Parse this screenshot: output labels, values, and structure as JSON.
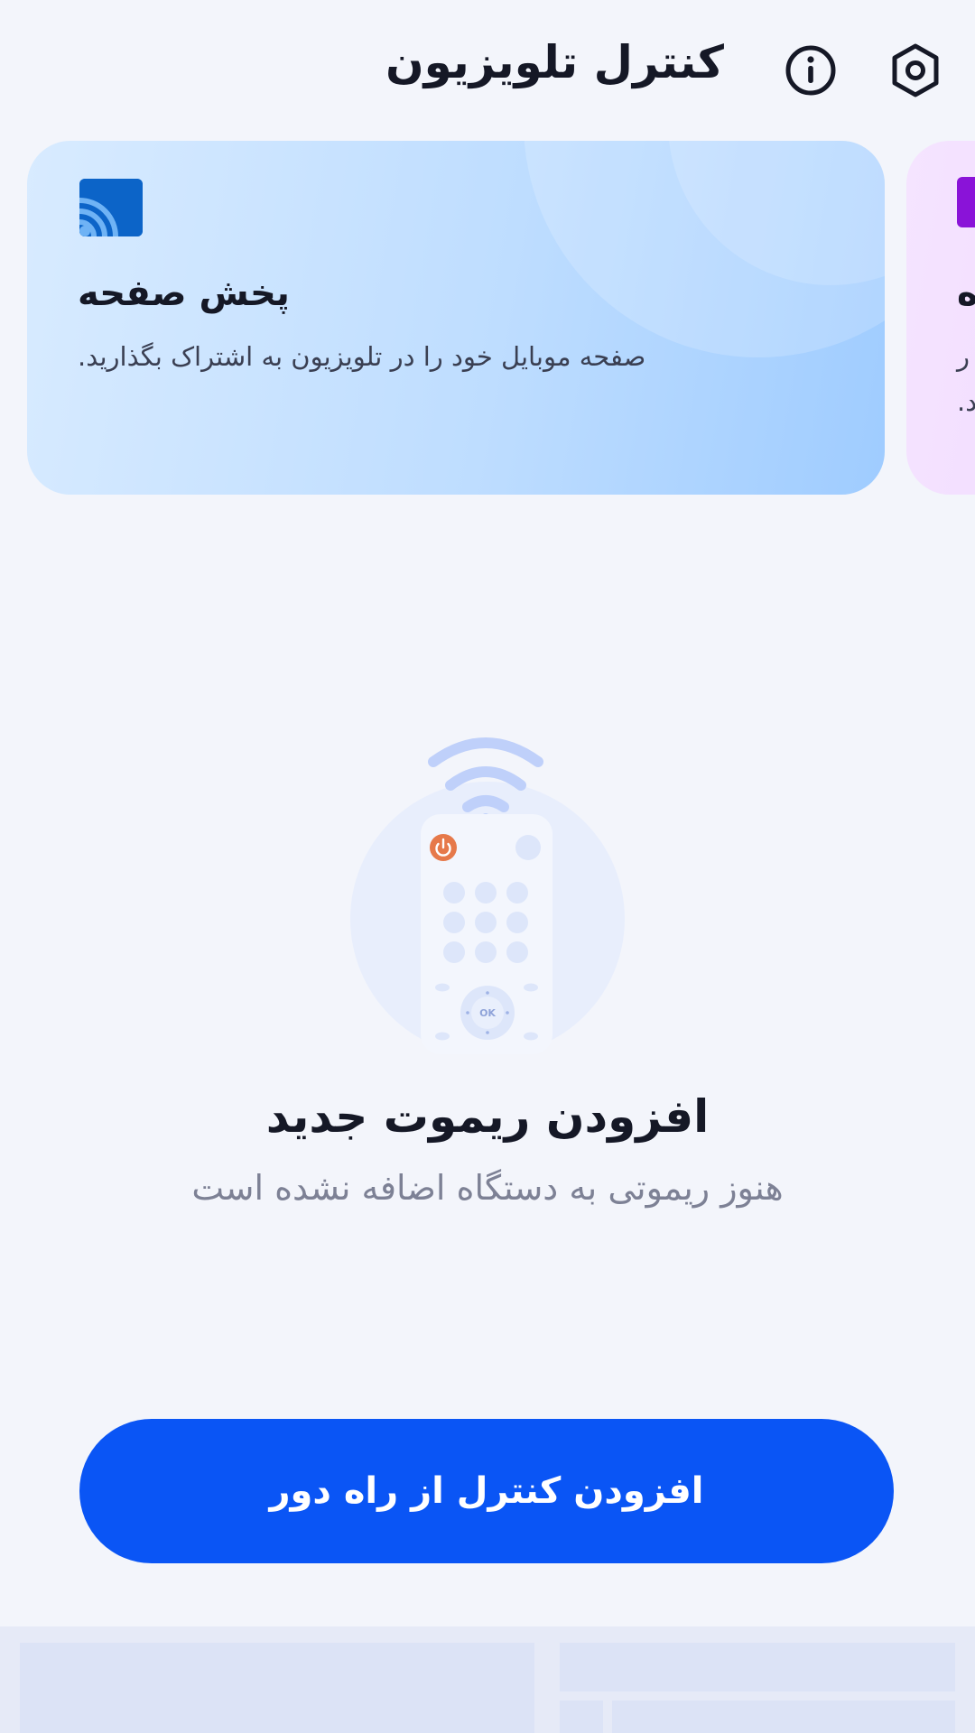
{
  "header": {
    "title": "کنترل تلویزیون",
    "settings_icon": "settings-hex-icon",
    "info_icon": "info-icon"
  },
  "cards": [
    {
      "title": "پخش صفحه",
      "subtitle": "صفحه موبایل خود را در تلویزیون به اشتراک بگذارید.",
      "icon": "cast-icon",
      "color": "#0C64C8"
    },
    {
      "title_fragment": "ه",
      "subtitle_line1_fragment": "ر",
      "subtitle_line2_fragment": "د.",
      "color": "#8A13D8"
    }
  ],
  "empty_state": {
    "title": "افزودن ریموت جدید",
    "subtitle": "هنوز ریموتی به دستگاه اضافه نشده است",
    "illustration": "remote-wifi-illustration",
    "ok_label": "OK"
  },
  "primary_button": {
    "label": "افزودن کنترل از راه دور",
    "color": "#0A55F5"
  }
}
